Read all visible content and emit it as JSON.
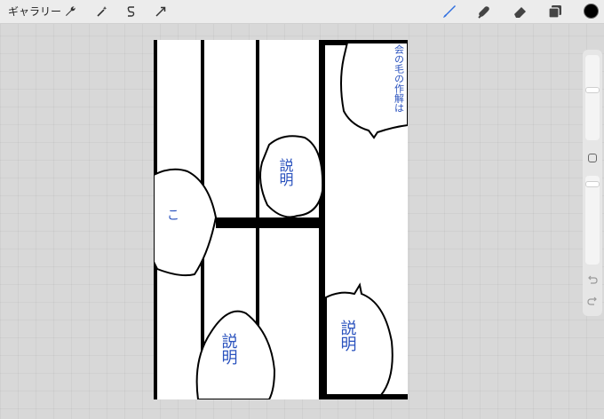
{
  "toolbar": {
    "gallery_label": "ギャラリー",
    "left_tools": [
      "wrench-icon",
      "magic-wand-icon",
      "selection-s-icon",
      "transform-arrow-icon"
    ],
    "right_tools": [
      "brush-icon",
      "smudge-icon",
      "eraser-icon",
      "layers-icon"
    ],
    "active_tool": "brush-icon",
    "accent_color": "#2f6fe0",
    "current_color": "#000000"
  },
  "canvas": {
    "handwritten_notes": {
      "top_right_bubble": "会の毛の作解は",
      "middle_bubble": "説明",
      "bottom_right_bubble": "説明",
      "bottom_left_bubble": "説明",
      "left_bubble": "こ"
    }
  },
  "sidebar": {
    "brush_size_level": 0.12,
    "opacity_level": 0.0
  }
}
